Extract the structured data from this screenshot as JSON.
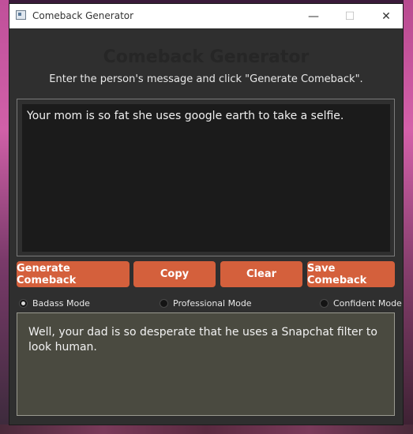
{
  "window": {
    "title": "Comeback Generator",
    "min_glyph": "—",
    "max_glyph": "☐",
    "close_glyph": "✕"
  },
  "header": {
    "title": "Comeback Generator",
    "instruction": "Enter the person's message and click \"Generate Comeback\"."
  },
  "input": {
    "value": "Your mom is so fat she uses google earth to take a selfie."
  },
  "buttons": {
    "generate": "Generate Comeback",
    "copy": "Copy",
    "clear": "Clear",
    "save": "Save Comeback"
  },
  "modes": [
    {
      "label": "Badass Mode",
      "selected": true
    },
    {
      "label": "Professional Mode",
      "selected": false
    },
    {
      "label": "Confident Mode",
      "selected": false
    }
  ],
  "output": {
    "text": "Well, your dad is so desperate that he uses a Snapchat filter to look human."
  },
  "colors": {
    "accent": "#d4603c",
    "output_bg": "#4a4a40",
    "input_bg": "#1b1b1b",
    "window_bg": "#2f2f2f"
  }
}
